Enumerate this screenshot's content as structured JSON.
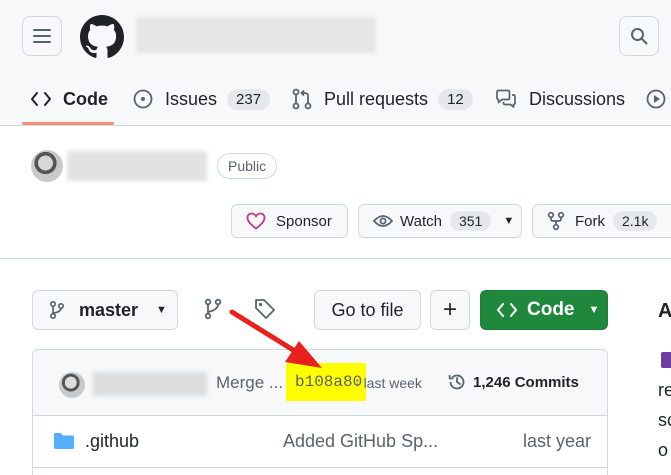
{
  "header": {
    "menu_icon": "hamburger-icon",
    "logo_icon": "github-logo-icon",
    "search_icon": "search-icon"
  },
  "tabs": [
    {
      "label": "Code",
      "icon": "code-icon",
      "active": true
    },
    {
      "label": "Issues",
      "icon": "issue-opened-icon",
      "count": "237"
    },
    {
      "label": "Pull requests",
      "icon": "git-pull-request-icon",
      "count": "12"
    },
    {
      "label": "Discussions",
      "icon": "comment-discussion-icon"
    }
  ],
  "repo": {
    "visibility": "Public",
    "sponsor_label": "Sponsor",
    "watch_label": "Watch",
    "watch_count": "351",
    "fork_label": "Fork",
    "fork_count": "2.1k"
  },
  "toolbar": {
    "branch_label": "master",
    "goto_file_label": "Go to file",
    "add_label": "+",
    "code_label": "Code",
    "about_partial": "A"
  },
  "commit": {
    "message": "Merge ...",
    "hash": "b108a80",
    "separator": "·",
    "time": "last week",
    "commits_label": "1,246 Commits"
  },
  "files": [
    {
      "name": ".github",
      "message": "Added GitHub Sp...",
      "time": "last year",
      "type": "folder"
    }
  ],
  "sidebar_partial": [
    "re",
    "sc",
    "o"
  ],
  "colors": {
    "accent_underline": "#fd8c73",
    "code_button_bg": "#1f883d",
    "highlight": "#ffff00",
    "annotation_arrow": "#e8211d"
  }
}
